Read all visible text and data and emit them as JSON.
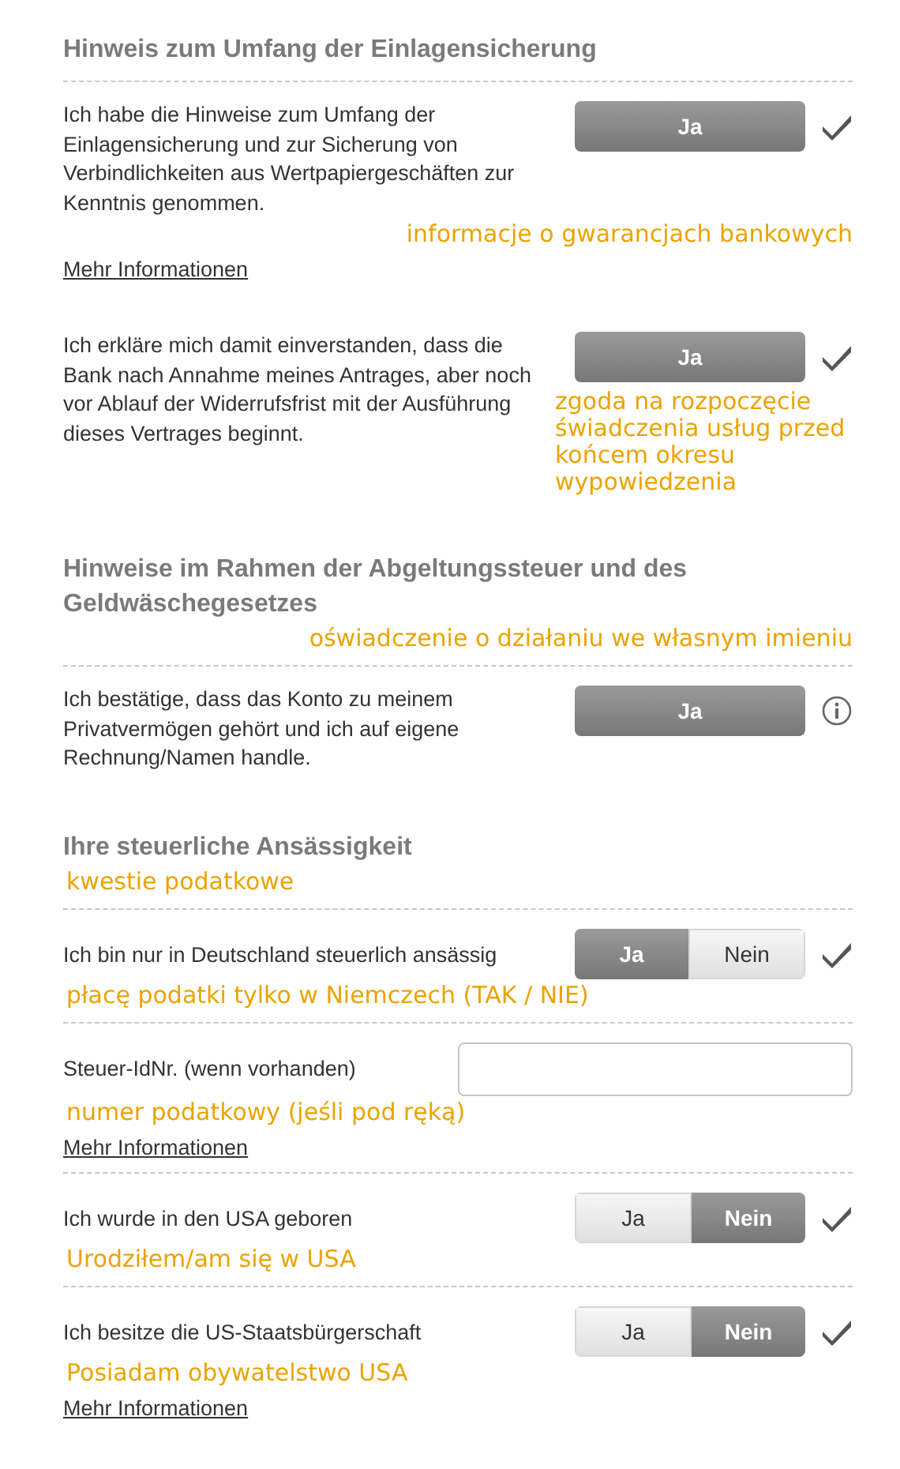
{
  "sections": [
    {
      "title": "Hinweis zum Umfang der Einlagensicherung",
      "rows": [
        {
          "kind": "confirm",
          "text": "Ich habe die Hinweise zum Umfang der Einlagensicherung und zur Sicherung von Verbindlichkeiten aus Wertpapiergeschäften zur Kenntnis genommen.",
          "options": [
            {
              "label": "Ja",
              "selected": true
            }
          ],
          "checked": true,
          "note_wide": "informacje o gwarancjach bankowych",
          "link": "Mehr Informationen"
        }
      ]
    },
    {
      "rows": [
        {
          "kind": "confirm",
          "text": "Ich erkläre mich damit einverstanden, dass die Bank nach Annahme meines Antrages, aber noch vor Ablauf der Widerrufsfrist mit der Ausführung dieses Vertrages beginnt.",
          "options": [
            {
              "label": "Ja",
              "selected": true
            }
          ],
          "checked": true,
          "note_right": "zgoda na rozpoczęcie świadczenia usług przed końcem okresu wypowiedzenia"
        }
      ]
    },
    {
      "title": "Hinweise im Rahmen der Abgeltungssteuer und des Geldwäschegesetzes",
      "title_note_wide": "oświadczenie o działaniu we własnym imieniu",
      "rows": [
        {
          "kind": "confirm",
          "text": "Ich bestätige, dass das Konto zu meinem Privatvermögen gehört und ich auf eigene Rechnung/Namen handle.",
          "options": [
            {
              "label": "Ja",
              "selected": true
            }
          ],
          "info": true
        }
      ]
    },
    {
      "title": "Ihre steuerliche Ansässigkeit",
      "title_note": "kwestie podatkowe",
      "rows": [
        {
          "kind": "choice",
          "text": "Ich bin nur in Deutschland steuerlich ansässig",
          "options": [
            {
              "label": "Ja",
              "selected": true
            },
            {
              "label": "Nein",
              "selected": false
            }
          ],
          "checked": true,
          "note": "płacę podatki tylko w Niemczech (TAK / NIE)"
        },
        {
          "kind": "field",
          "text": "Steuer-IdNr. (wenn vorhanden)",
          "note": "numer podatkowy (jeśli pod ręką)",
          "link": "Mehr Informationen"
        },
        {
          "kind": "choice",
          "text": "Ich wurde in den USA geboren",
          "options": [
            {
              "label": "Ja",
              "selected": false
            },
            {
              "label": "Nein",
              "selected": true
            }
          ],
          "checked": true,
          "note": "Urodziłem/am się w USA"
        },
        {
          "kind": "choice",
          "text": "Ich besitze die US-Staatsbürgerschaft",
          "options": [
            {
              "label": "Ja",
              "selected": false
            },
            {
              "label": "Nein",
              "selected": true
            }
          ],
          "checked": true,
          "note": "Posiadam obywatelstwo USA",
          "link": "Mehr Informationen"
        }
      ]
    }
  ]
}
